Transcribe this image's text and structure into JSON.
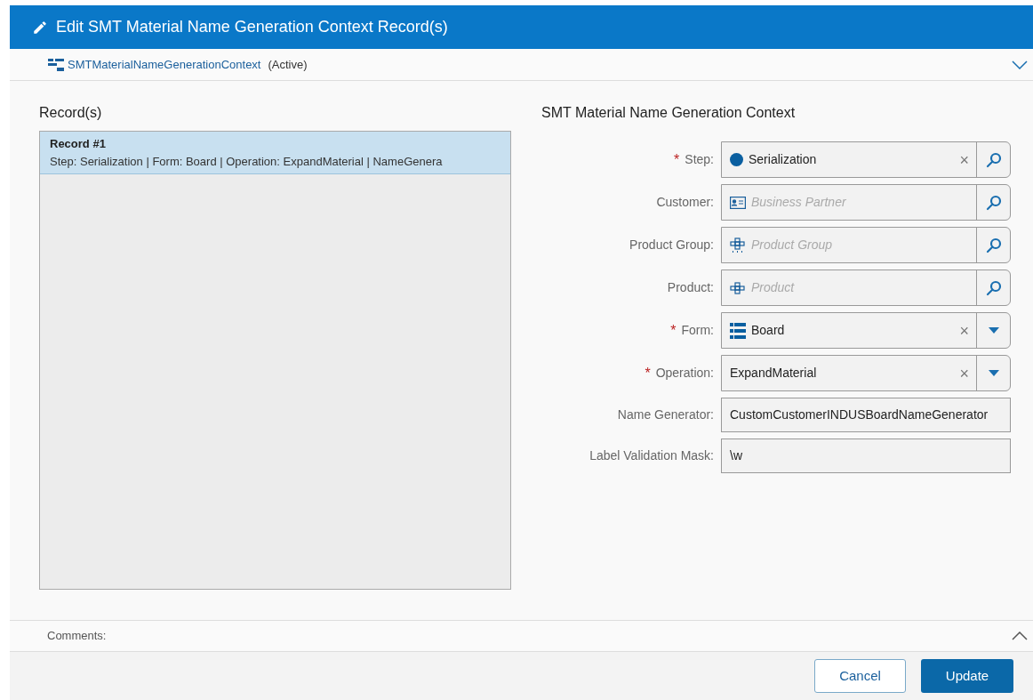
{
  "dialog": {
    "title": "Edit SMT Material Name Generation Context Record(s)"
  },
  "entity": {
    "name": "SMTMaterialNameGenerationContext",
    "status": "(Active)",
    "expanded": false
  },
  "records": {
    "heading": "Record(s)",
    "items": [
      {
        "title": "Record #1",
        "summary": "Step: Serialization | Form: Board | Operation: ExpandMaterial | NameGenera",
        "selected": true
      }
    ]
  },
  "form": {
    "heading": "SMT Material Name Generation Context",
    "fields": [
      {
        "label": "Step:",
        "required_mark": "*",
        "kind": "lookup",
        "value": "Serialization",
        "clear_button": "×"
      },
      {
        "label": "Customer:",
        "kind": "lookup",
        "placeholder": "Business Partner"
      },
      {
        "label": "Product Group:",
        "kind": "lookup",
        "placeholder": "Product Group"
      },
      {
        "label": "Product:",
        "kind": "lookup",
        "placeholder": "Product"
      },
      {
        "label": "Form:",
        "required_mark": "*",
        "kind": "dropdown",
        "value": "Board",
        "clear_button": "×"
      },
      {
        "label": "Operation:",
        "required_mark": "*",
        "kind": "dropdown",
        "value": "ExpandMaterial",
        "clear_button": "×"
      },
      {
        "label": "Name Generator:",
        "kind": "text",
        "value": "CustomCustomerINDUSBoardNameGenerator"
      },
      {
        "label": "Label Validation Mask:",
        "kind": "text",
        "value": "\\w"
      }
    ]
  },
  "comments": {
    "label": "Comments:",
    "expanded": false
  },
  "buttons": [
    {
      "label": "Cancel",
      "kind": "secondary"
    },
    {
      "label": "Update",
      "kind": "primary"
    }
  ]
}
